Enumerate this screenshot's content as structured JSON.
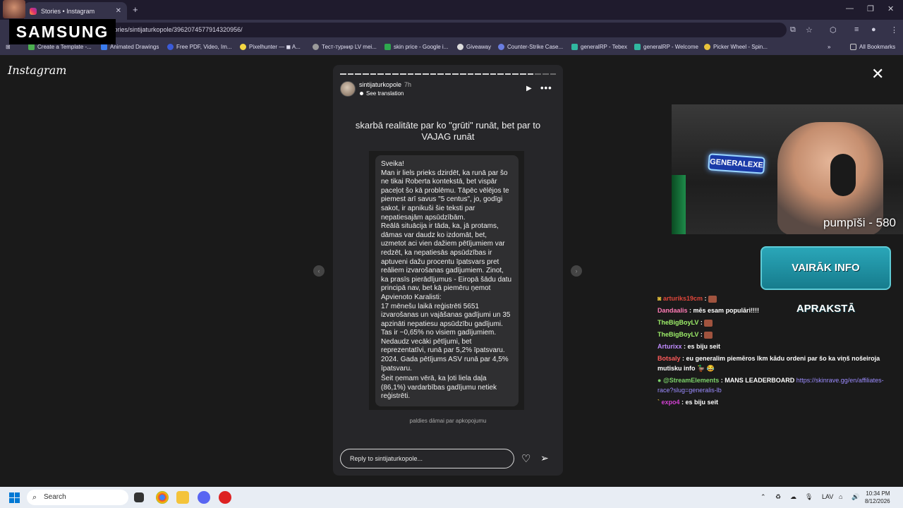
{
  "overlay": {
    "brand": "SAMSUNG"
  },
  "browser": {
    "tab_title": "Stories • Instagram",
    "url": "/stories/sintijaturkopole/3962074577914320956/",
    "bookmarks": [
      "Create a Template -...",
      "Animated Drawings",
      "Free PDF, Video, Im...",
      "Pixelhunter — ◼ A...",
      "Тест-турнир LV mei...",
      "skin price - Google i...",
      "Giveaway",
      "Counter-Strike Case...",
      "generalRP - Tebex",
      "generalRP - Welcome",
      "Picker Wheel - Spin..."
    ],
    "all_bookmarks": "All Bookmarks"
  },
  "instagram": {
    "logo": "Instagram",
    "story": {
      "username": "sintijaturkopole",
      "time_ago": "7h",
      "see_translation": "See translation",
      "headline": "skarbā realitāte par ko \"grūti\" runāt, bet par to VAJAG runāt",
      "note_lines": [
        "Sveika!",
        "Man ir liels prieks dzirdēt, ka runā par šo ne tikai Roberta kontekstā, bet vispār paceļot šo kā problēmu. Tāpēc vēlējos te piemest arī savus \"5 centus\", jo, godīgi sakot, ir apnikuši šie teksti par nepatiesajām apsūdzībām.",
        "Reālā situācija ir tāda, ka, jā protams, dāmas var daudz ko izdomāt, bet, uzmetot aci vien dažiem pētījumiem var redzēt, ka nepatiesās apsūdzības ir aptuveni dažu procentu īpatsvars pret reāliem izvarošanas gadījumiem. Zinot, ka prasīs pierādījumus - Eiropā šādu datu principā nav, bet kā piemēru ņemot Apvienoto Karalisti:",
        "17 mēnešu laikā reģistrēti 5651 izvarošanas un vajāšanas gadījumi un 35 apzināti nepatiesu apsūdzību gadījumi. Tas ir ~0,65% no visiem gadījumiem.",
        "Nedaudz vecāki pētījumi, bet reprezentatīvi, runā par 5,2% īpatsvaru.",
        "2024.  Gada pētījums ASV runā par 4,5% īpatsvaru.",
        "Šeit ņemam vērā, ka ļoti liela daļa (86,1%) vardarbības gadījumu netiek reģistrēti."
      ],
      "caption": "paldies dāmai par apkopojumu",
      "reply_placeholder": "Reply to sintijaturkopole..."
    }
  },
  "stream": {
    "counter": "pumpīši - 580",
    "banner": "VAIRĀK INFO APRAKSTĀ",
    "neon_sign": "GENERALEXE",
    "chat": [
      {
        "user": "arturiks19cm",
        "user_color": "#e0463a",
        "text": "",
        "emote": true
      },
      {
        "user": "Dandaalis",
        "user_color": "#ff7bb5",
        "text": "mēs esam populāri!!!!",
        "emote": false
      },
      {
        "user": "TheBigBoyLV",
        "user_color": "#9ef06a",
        "text": "",
        "emote": true
      },
      {
        "user": "TheBigBoyLV",
        "user_color": "#9ef06a",
        "text": "",
        "emote": true
      },
      {
        "user": "Arturixx",
        "user_color": "#c08cff",
        "text": "es biju seit",
        "emote": false
      },
      {
        "user": "Botsaly",
        "user_color": "#ff5b5b",
        "text": "eu generalim piemēros lkm kādu ordeni par šo ka viņš nošeiroja mutisku info 🦆 😂",
        "emote": false
      },
      {
        "user": "@StreamElements",
        "user_color": "#7cd36a",
        "text": "MANS LEADERBOARD",
        "link": "https://skinrave.gg/en/affiliates-race?slug=generalis-lb",
        "emote": false
      },
      {
        "user": "expo4",
        "user_color": "#d040d0",
        "text": "es biju seit",
        "emote": false
      }
    ]
  },
  "taskbar": {
    "search_placeholder": "Search",
    "language": "LAV",
    "time": "10:34 PM",
    "date": "8/12/2026"
  }
}
